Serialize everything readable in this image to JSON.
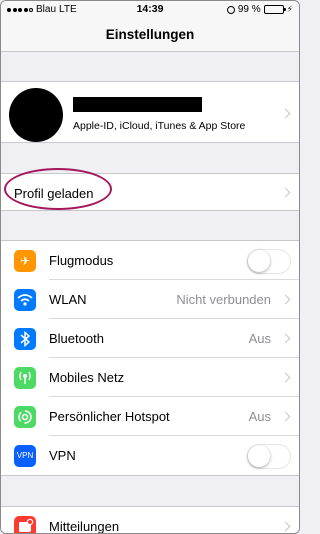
{
  "status_bar": {
    "carrier": "Blau",
    "network": "LTE",
    "time": "14:39",
    "battery": "99 %"
  },
  "nav": {
    "title": "Einstellungen"
  },
  "profile": {
    "subtitle": "Apple-ID, iCloud, iTunes & App Store"
  },
  "profile_loaded": {
    "label": "Profil geladen"
  },
  "settings": [
    {
      "label": "Flugmodus",
      "icon": "airplane-icon",
      "color": "#ff9500",
      "control": "toggle",
      "on": false
    },
    {
      "label": "WLAN",
      "icon": "wifi-icon",
      "color": "#007aff",
      "value": "Nicht verbunden"
    },
    {
      "label": "Bluetooth",
      "icon": "bluetooth-icon",
      "color": "#007aff",
      "value": "Aus"
    },
    {
      "label": "Mobiles Netz",
      "icon": "cellular-icon",
      "color": "#4cd964"
    },
    {
      "label": "Persönlicher Hotspot",
      "icon": "hotspot-icon",
      "color": "#4cd964",
      "value": "Aus"
    },
    {
      "label": "VPN",
      "icon": "vpn-icon",
      "icon_text": "VPN",
      "color": "#0a60ff",
      "control": "toggle",
      "on": false
    }
  ],
  "notifications": {
    "label": "Mitteilungen",
    "icon": "notifications-icon",
    "color": "#ff3b30"
  },
  "colors": {
    "highlight": "#a4195c",
    "background": "#efeff4"
  }
}
